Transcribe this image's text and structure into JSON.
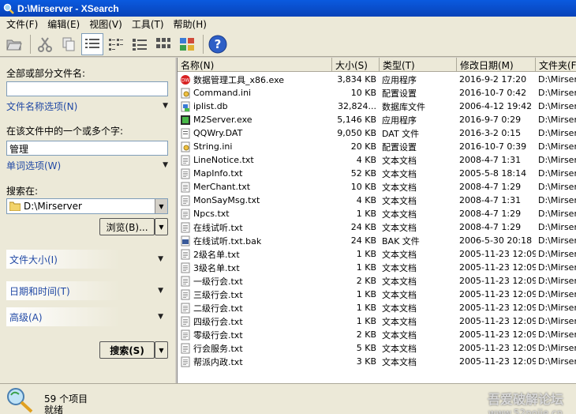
{
  "window": {
    "title": "D:\\Mirserver - XSearch"
  },
  "menu": [
    "文件(F)",
    "编辑(E)",
    "视图(V)",
    "工具(T)",
    "帮助(H)"
  ],
  "toolbar": {
    "icons": [
      "open-folder-icon",
      "cut-icon",
      "copy-icon",
      "details-view-icon",
      "list-view-icon",
      "small-icons-view-icon",
      "large-icons-view-icon",
      "thumbnails-view-icon",
      "help-icon"
    ]
  },
  "search_panel": {
    "filename_label": "全部或部分文件名:",
    "filename_value": "",
    "filename_options": "文件名称选项(N)",
    "text_label": "在该文件中的一个或多个字:",
    "text_value": "管理",
    "word_options": "单词选项(W)",
    "search_in_label": "搜索在:",
    "search_in_value": "D:\\Mirserver",
    "browse_label": "浏览(B)...",
    "file_size_section": "文件大小(I)",
    "date_time_section": "日期和时间(T)",
    "advanced_section": "高级(A)",
    "search_button": "搜索(S)"
  },
  "list": {
    "columns": [
      "名称(N)",
      "大小(S)",
      "类型(T)",
      "修改日期(M)",
      "文件夹(F)"
    ],
    "rows": [
      {
        "name": "数据管理工具_x86.exe",
        "size": "3,834 KB",
        "type": "应用程序",
        "date": "2016-9-2 17:20",
        "folder": "D:\\Mirserver",
        "icon": "app-red"
      },
      {
        "name": "Command.ini",
        "size": "10 KB",
        "type": "配置设置",
        "date": "2016-10-7 0:42",
        "folder": "D:\\Mirserver",
        "icon": "ini"
      },
      {
        "name": "iplist.db",
        "size": "32,824...",
        "type": "数据库文件",
        "date": "2006-4-12 19:42",
        "folder": "D:\\Mirserver",
        "icon": "db"
      },
      {
        "name": "M2Server.exe",
        "size": "5,146 KB",
        "type": "应用程序",
        "date": "2016-9-7 0:29",
        "folder": "D:\\Mirserver",
        "icon": "app-green"
      },
      {
        "name": "QQWry.DAT",
        "size": "9,050 KB",
        "type": "DAT 文件",
        "date": "2016-3-2 0:15",
        "folder": "D:\\Mirserver",
        "icon": "dat"
      },
      {
        "name": "String.ini",
        "size": "20 KB",
        "type": "配置设置",
        "date": "2016-10-7 0:39",
        "folder": "D:\\Mirserver",
        "icon": "ini"
      },
      {
        "name": "LineNotice.txt",
        "size": "4 KB",
        "type": "文本文档",
        "date": "2008-4-7 1:31",
        "folder": "D:\\Mirserver",
        "icon": "txt"
      },
      {
        "name": "MapInfo.txt",
        "size": "52 KB",
        "type": "文本文档",
        "date": "2005-5-8 18:14",
        "folder": "D:\\Mirserver",
        "icon": "txt"
      },
      {
        "name": "MerChant.txt",
        "size": "10 KB",
        "type": "文本文档",
        "date": "2008-4-7 1:29",
        "folder": "D:\\Mirserver",
        "icon": "txt"
      },
      {
        "name": "MonSayMsg.txt",
        "size": "4 KB",
        "type": "文本文档",
        "date": "2008-4-7 1:31",
        "folder": "D:\\Mirserver",
        "icon": "txt"
      },
      {
        "name": "Npcs.txt",
        "size": "1 KB",
        "type": "文本文档",
        "date": "2008-4-7 1:29",
        "folder": "D:\\Mirserver",
        "icon": "txt"
      },
      {
        "name": "在线试听.txt",
        "size": "24 KB",
        "type": "文本文档",
        "date": "2008-4-7 1:29",
        "folder": "D:\\Mirserver",
        "icon": "txt"
      },
      {
        "name": "在线试听.txt.bak",
        "size": "24 KB",
        "type": "BAK 文件",
        "date": "2006-5-30 20:18",
        "folder": "D:\\Mirserver",
        "icon": "bak"
      },
      {
        "name": "2级名单.txt",
        "size": "1 KB",
        "type": "文本文档",
        "date": "2005-11-23 12:09",
        "folder": "D:\\Mirserver",
        "icon": "txt"
      },
      {
        "name": "3级名单.txt",
        "size": "1 KB",
        "type": "文本文档",
        "date": "2005-11-23 12:09",
        "folder": "D:\\Mirserver",
        "icon": "txt"
      },
      {
        "name": "一级行会.txt",
        "size": "2 KB",
        "type": "文本文档",
        "date": "2005-11-23 12:09",
        "folder": "D:\\Mirserver",
        "icon": "txt"
      },
      {
        "name": "三级行会.txt",
        "size": "1 KB",
        "type": "文本文档",
        "date": "2005-11-23 12:09",
        "folder": "D:\\Mirserver",
        "icon": "txt"
      },
      {
        "name": "二级行会.txt",
        "size": "1 KB",
        "type": "文本文档",
        "date": "2005-11-23 12:09",
        "folder": "D:\\Mirserver",
        "icon": "txt"
      },
      {
        "name": "四级行会.txt",
        "size": "1 KB",
        "type": "文本文档",
        "date": "2005-11-23 12:09",
        "folder": "D:\\Mirserver",
        "icon": "txt"
      },
      {
        "name": "零级行会.txt",
        "size": "2 KB",
        "type": "文本文档",
        "date": "2005-11-23 12:09",
        "folder": "D:\\Mirserver",
        "icon": "txt"
      },
      {
        "name": "行会服务.txt",
        "size": "5 KB",
        "type": "文本文档",
        "date": "2005-11-23 12:09",
        "folder": "D:\\Mirserver",
        "icon": "txt"
      },
      {
        "name": "帮派内政.txt",
        "size": "3 KB",
        "type": "文本文档",
        "date": "2005-11-23 12:09",
        "folder": "D:\\Mirserver",
        "icon": "txt"
      }
    ]
  },
  "status": {
    "count": "59 个项目",
    "state": "就绪"
  },
  "watermark": {
    "line1": "吾爱破解论坛",
    "line2": "www.52pojie.cn"
  }
}
